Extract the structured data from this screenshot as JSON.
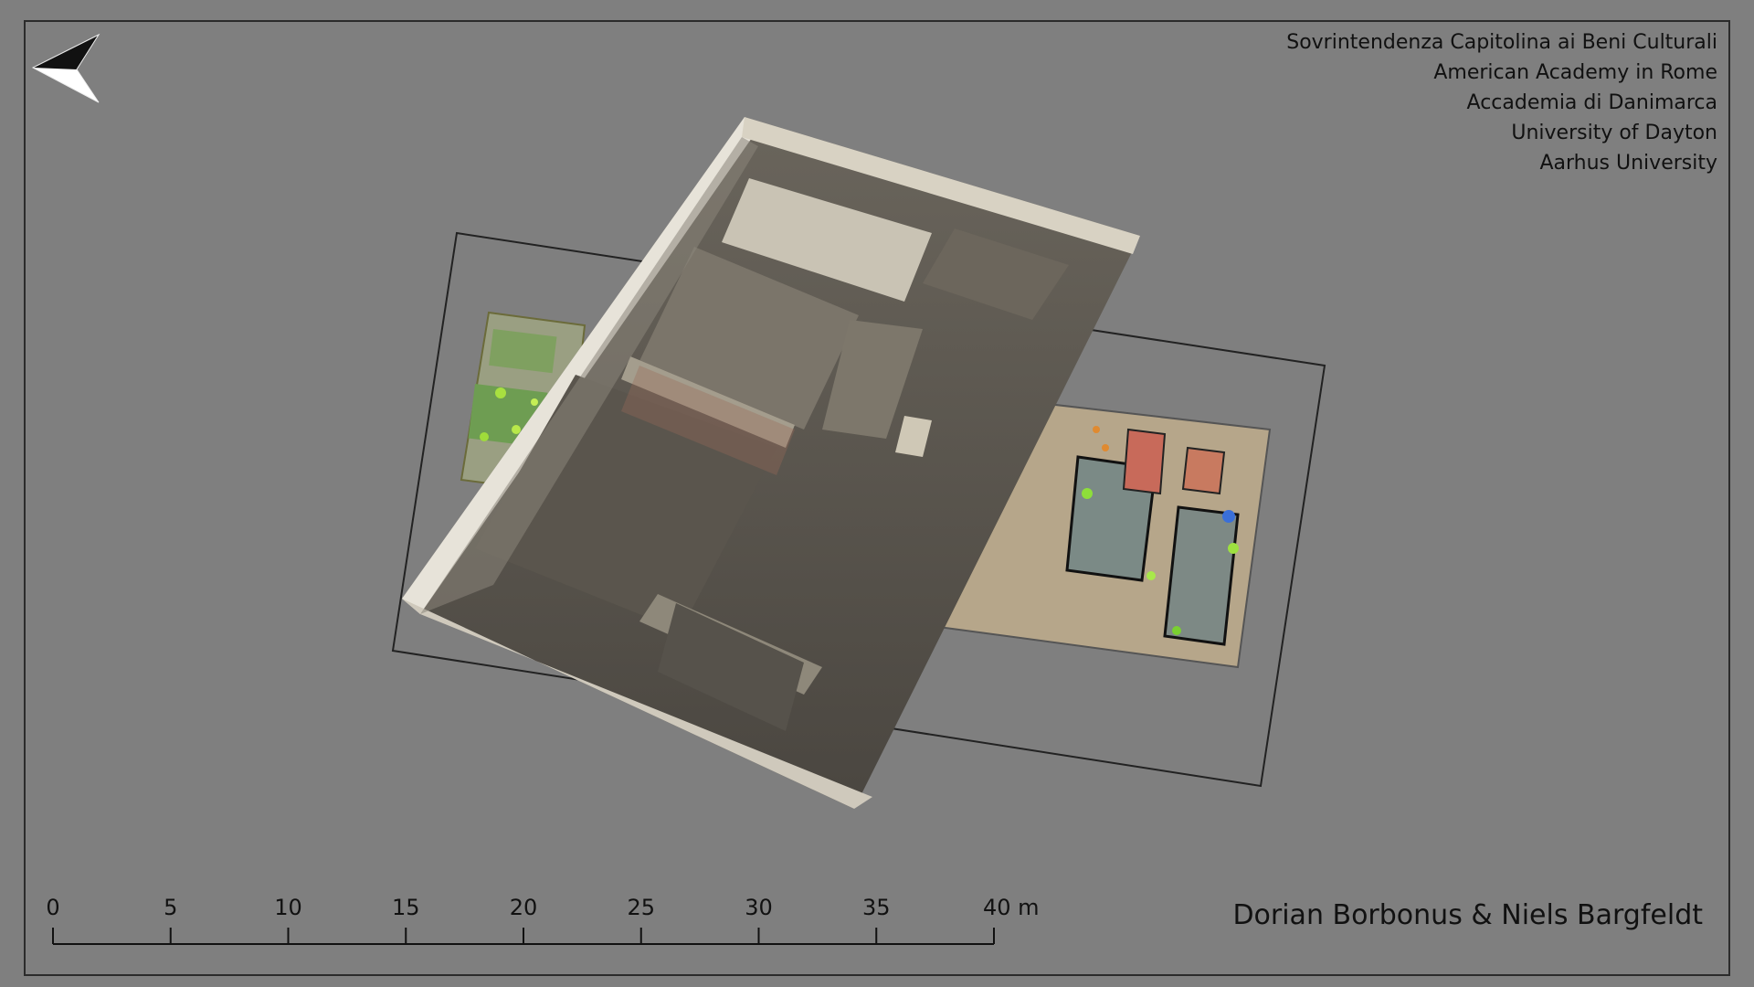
{
  "map": {
    "credits": [
      "Sovrintendenza Capitolina ai Beni Culturali",
      "American Academy in Rome",
      "Accademia di Danimarca",
      "University of Dayton",
      "Aarhus University"
    ],
    "authors": "Dorian Borbonus & Niels Bargfeldt",
    "north_arrow": "north-arrow-icon",
    "background_color": "#7f7f7f",
    "scale": {
      "ticks": [
        "0",
        "5",
        "10",
        "15",
        "20",
        "25",
        "30",
        "35",
        "40 m"
      ],
      "unit": "m",
      "max_value": 40
    }
  }
}
